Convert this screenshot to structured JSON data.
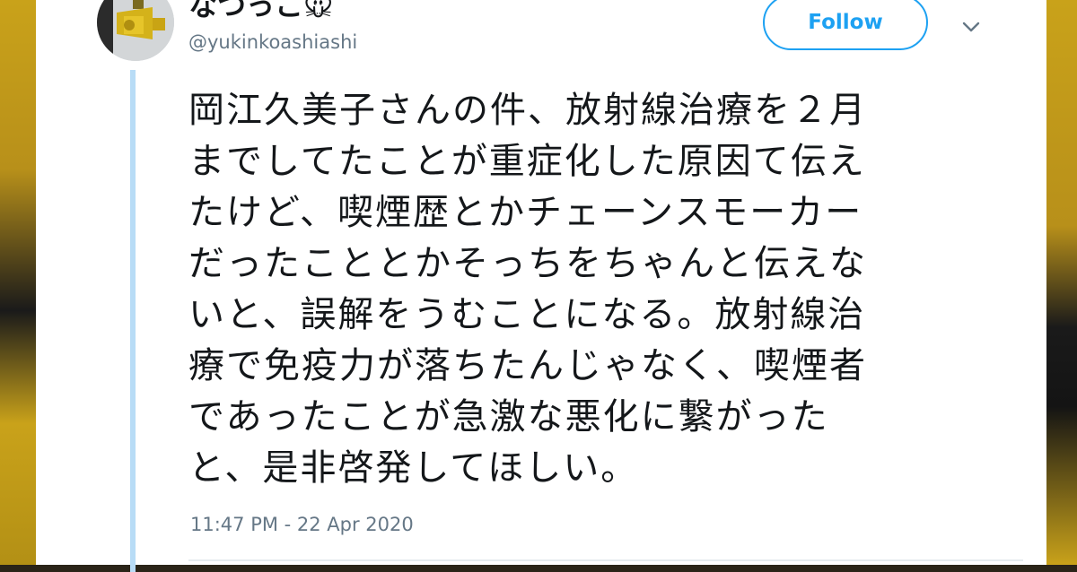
{
  "user": {
    "display_name": "なつっこ🐭",
    "handle": "@yukinkoashiashi"
  },
  "follow_button": {
    "label": "Follow"
  },
  "menu": {
    "icon": "chevron-down-icon"
  },
  "tweet": {
    "lines": [
      "岡江久美子さんの件、放射線治療を２月",
      "までしてたことが重症化した原因て伝え",
      "たけど、喫煙歴とかチェーンスモーカー",
      "だったこととかそっちをちゃんと伝えな",
      "いと、誤解をうむことになる。放射線治",
      "療で免疫力が落ちたんじゃなく、喫煙者",
      "であったことが急激な悪化に繋がった",
      "と、是非啓発してほしい。"
    ],
    "timestamp": "11:47 PM - 22 Apr 2020"
  },
  "colors": {
    "accent": "#1da1f2",
    "thread_line": "#b8dcf6",
    "secondary_text": "#657786"
  }
}
